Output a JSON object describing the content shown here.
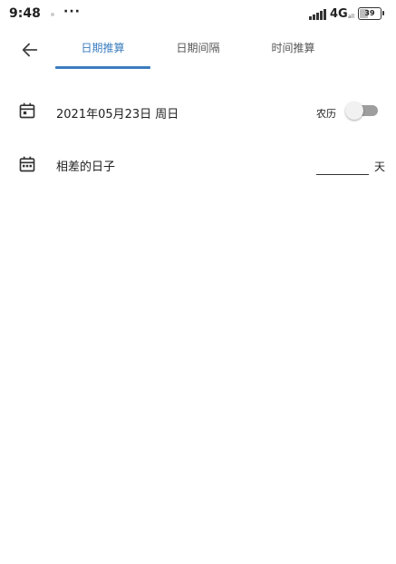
{
  "status_bar": {
    "time": "9:48",
    "more": "···",
    "network": "4G",
    "network_sub": "all",
    "battery": "39",
    "battery_level": 0.39
  },
  "tabs": [
    {
      "label": "日期推算",
      "active": true
    },
    {
      "label": "日期间隔",
      "active": false
    },
    {
      "label": "时间推算",
      "active": false
    }
  ],
  "date_row": {
    "value": "2021年05月23日 周日",
    "lunar_label": "农历",
    "lunar_on": false
  },
  "days_row": {
    "label": "相差的日子",
    "input_value": "",
    "unit": "天"
  },
  "colors": {
    "accent": "#3b7dbf",
    "text": "#222222",
    "toggle_track": "#9e9e9e"
  }
}
